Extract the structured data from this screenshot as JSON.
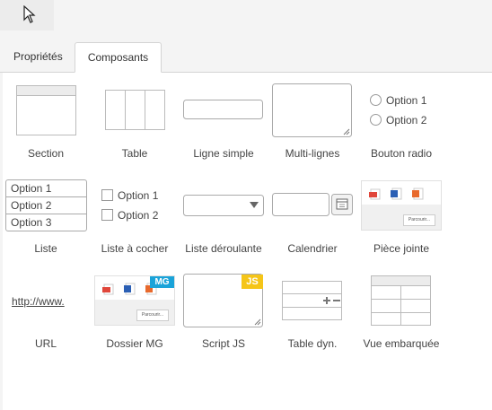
{
  "tabs": [
    {
      "label": "Propriétés",
      "active": false
    },
    {
      "label": "Composants",
      "active": true
    }
  ],
  "components": {
    "section": {
      "label": "Section",
      "icon": "section-icon"
    },
    "table": {
      "label": "Table",
      "icon": "table-icon"
    },
    "single_line": {
      "label": "Ligne simple",
      "icon": "text-input-icon"
    },
    "multi_line": {
      "label": "Multi-lignes",
      "icon": "textarea-icon"
    },
    "radio": {
      "label": "Bouton radio",
      "options": [
        "Option 1",
        "Option 2"
      ]
    },
    "list": {
      "label": "Liste",
      "options": [
        "Option 1",
        "Option 2",
        "Option 3"
      ]
    },
    "checkbox": {
      "label": "Liste à cocher",
      "options": [
        "Option 1",
        "Option 2"
      ]
    },
    "dropdown": {
      "label": "Liste déroulante",
      "icon": "dropdown-icon"
    },
    "calendar": {
      "label": "Calendrier",
      "icon": "calendar-icon"
    },
    "attachment": {
      "label": "Pièce jointe",
      "browse": "Parcourir..."
    },
    "url": {
      "label": "URL",
      "sample": "http://www."
    },
    "mg_folder": {
      "label": "Dossier MG",
      "badge": "MG",
      "browse": "Parcourir..."
    },
    "script_js": {
      "label": "Script JS",
      "badge": "JS"
    },
    "dyn_table": {
      "label": "Table dyn.",
      "icon": "dynamic-table-icon"
    },
    "embedded_view": {
      "label": "Vue embarquée",
      "icon": "embedded-view-icon"
    }
  },
  "colors": {
    "js_badge": "#f5c518",
    "mg_badge": "#1aa3d9",
    "pdf": "#e0463a",
    "word": "#2b5fb4",
    "powerpoint": "#e8692c"
  }
}
